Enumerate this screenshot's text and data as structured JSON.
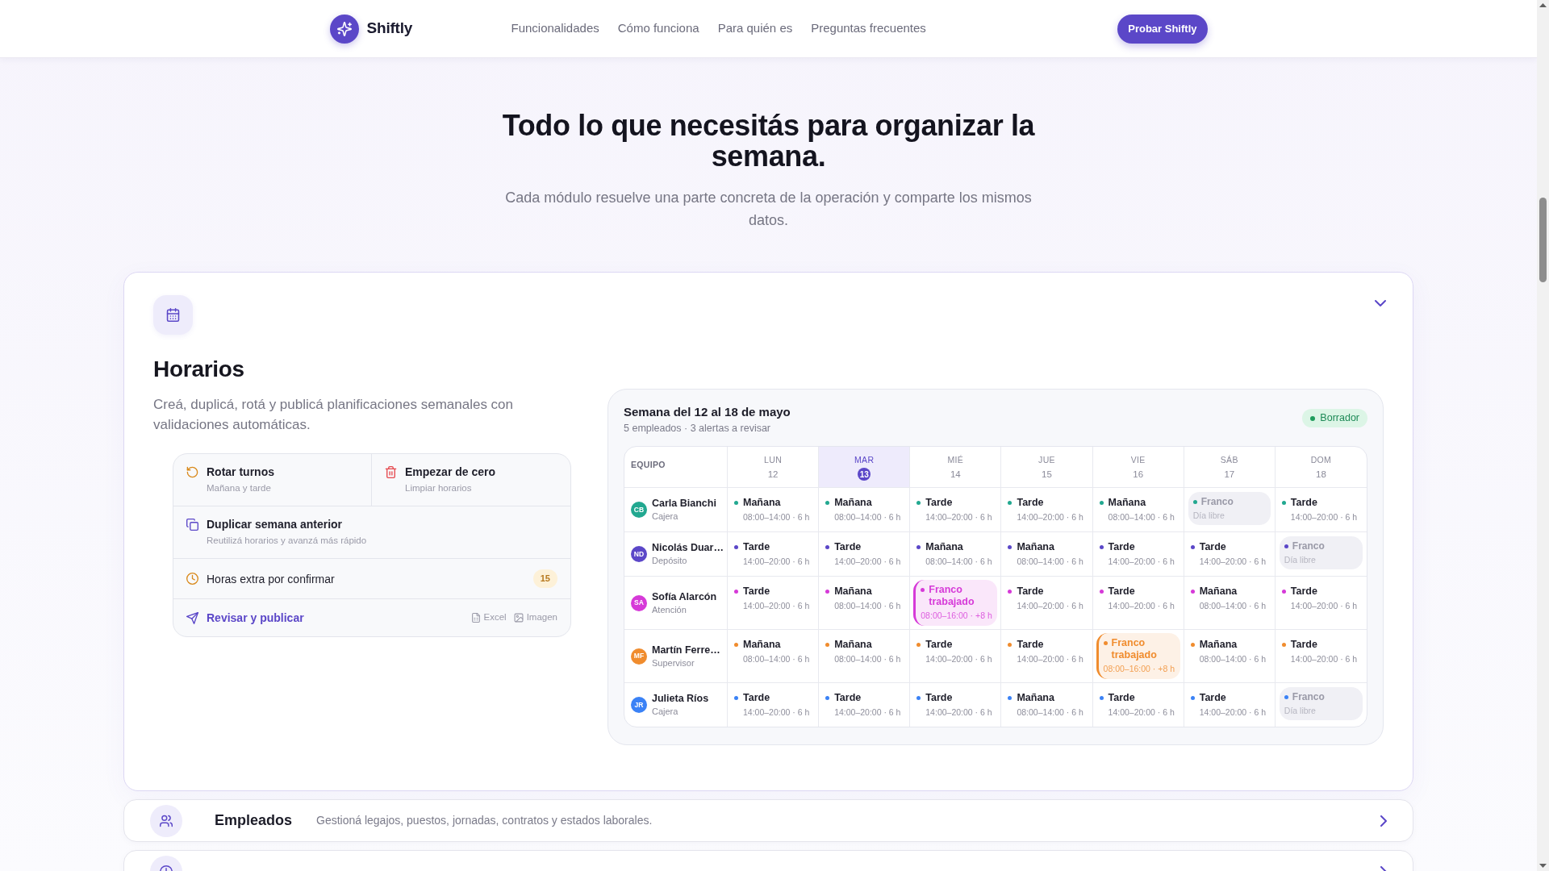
{
  "header": {
    "logo": "Shiftly",
    "nav": [
      "Funcionalidades",
      "Cómo funciona",
      "Para quién es",
      "Preguntas frecuentes"
    ],
    "cta": "Probar Shiftly"
  },
  "hero": {
    "title": "Todo lo que necesitás para organizar la semana.",
    "subtitle": "Cada módulo resuelve una parte concreta de la operación y comparte los mismos datos."
  },
  "modules": [
    {
      "title": "Horarios",
      "description": "Creá, duplicá, rotá y publicá planificaciones semanales con validaciones automáticas.",
      "expanded": true,
      "action_rows": [
        [
          {
            "kind": "action",
            "title": "Rotar turnos",
            "subtitle": "Mañana y tarde"
          },
          {
            "kind": "action",
            "title": "Empezar de cero",
            "subtitle": "Limpiar horarios"
          }
        ],
        [
          {
            "kind": "action",
            "title": "Duplicar semana anterior",
            "subtitle": "Reutilizá horarios y avanzá más rápido"
          }
        ],
        [
          {
            "kind": "pending",
            "title": "Horas extra por confirmar",
            "count": "15"
          }
        ],
        [
          {
            "kind": "publish",
            "title": "Revisar y publicar",
            "exports": [
              "Excel",
              "Imagen"
            ]
          }
        ]
      ],
      "schedule": {
        "title": "Semana del 12 al 18 de mayo",
        "subtitle": "5 empleados · 3 alertas a revisar",
        "status": "Borrador",
        "team_header": "EQUIPO",
        "days": [
          {
            "name": "LUN",
            "date": "12",
            "selected": false
          },
          {
            "name": "MAR",
            "date": "13",
            "selected": true
          },
          {
            "name": "MIÉ",
            "date": "14",
            "selected": false
          },
          {
            "name": "JUE",
            "date": "15",
            "selected": false
          },
          {
            "name": "VIE",
            "date": "16",
            "selected": false
          },
          {
            "name": "SÁB",
            "date": "17",
            "selected": false
          },
          {
            "name": "DOM",
            "date": "18",
            "selected": false
          }
        ],
        "employees": [
          {
            "initials": "CB",
            "name": "Carla Bianchi",
            "role": "Cajera",
            "color": "#22a890",
            "shifts": [
              {
                "kind": "shift",
                "label": "Mañana",
                "time": "08:00–14:00 · 6 h"
              },
              {
                "kind": "shift",
                "label": "Mañana",
                "time": "08:00–14:00 · 6 h"
              },
              {
                "kind": "shift",
                "label": "Tarde",
                "time": "14:00–20:00 · 6 h"
              },
              {
                "kind": "shift",
                "label": "Tarde",
                "time": "14:00–20:00 · 6 h"
              },
              {
                "kind": "shift",
                "label": "Mañana",
                "time": "08:00–14:00 · 6 h"
              },
              {
                "kind": "off",
                "label": "Franco",
                "note": "Día libre"
              },
              {
                "kind": "shift",
                "label": "Tarde",
                "time": "14:00–20:00 · 6 h"
              }
            ]
          },
          {
            "initials": "ND",
            "name": "Nicolás Duar…",
            "role": "Depósito",
            "color": "#5b47c8",
            "shifts": [
              {
                "kind": "shift",
                "label": "Tarde",
                "time": "14:00–20:00 · 6 h"
              },
              {
                "kind": "shift",
                "label": "Tarde",
                "time": "14:00–20:00 · 6 h"
              },
              {
                "kind": "shift",
                "label": "Mañana",
                "time": "08:00–14:00 · 6 h"
              },
              {
                "kind": "shift",
                "label": "Mañana",
                "time": "08:00–14:00 · 6 h"
              },
              {
                "kind": "shift",
                "label": "Tarde",
                "time": "14:00–20:00 · 6 h"
              },
              {
                "kind": "shift",
                "label": "Tarde",
                "time": "14:00–20:00 · 6 h"
              },
              {
                "kind": "off",
                "label": "Franco",
                "note": "Día libre"
              }
            ]
          },
          {
            "initials": "SA",
            "name": "Sofía Alarcón",
            "role": "Atención",
            "color": "#d63ad8",
            "shifts": [
              {
                "kind": "shift",
                "label": "Tarde",
                "time": "14:00–20:00 · 6 h"
              },
              {
                "kind": "shift",
                "label": "Mañana",
                "time": "08:00–14:00 · 6 h"
              },
              {
                "kind": "worked_off",
                "label": "Franco trabajado",
                "time": "08:00–16:00 · +8 h"
              },
              {
                "kind": "shift",
                "label": "Tarde",
                "time": "14:00–20:00 · 6 h"
              },
              {
                "kind": "shift",
                "label": "Tarde",
                "time": "14:00–20:00 · 6 h"
              },
              {
                "kind": "shift",
                "label": "Mañana",
                "time": "08:00–14:00 · 6 h"
              },
              {
                "kind": "shift",
                "label": "Tarde",
                "time": "14:00–20:00 · 6 h"
              }
            ]
          },
          {
            "initials": "MF",
            "name": "Martín Ferre…",
            "role": "Supervisor",
            "color": "#f08c2e",
            "shifts": [
              {
                "kind": "shift",
                "label": "Mañana",
                "time": "08:00–14:00 · 6 h"
              },
              {
                "kind": "shift",
                "label": "Mañana",
                "time": "08:00–14:00 · 6 h"
              },
              {
                "kind": "shift",
                "label": "Tarde",
                "time": "14:00–20:00 · 6 h"
              },
              {
                "kind": "shift",
                "label": "Tarde",
                "time": "14:00–20:00 · 6 h"
              },
              {
                "kind": "worked_off",
                "label": "Franco trabajado",
                "time": "08:00–16:00 · +8 h"
              },
              {
                "kind": "shift",
                "label": "Mañana",
                "time": "08:00–14:00 · 6 h"
              },
              {
                "kind": "shift",
                "label": "Tarde",
                "time": "14:00–20:00 · 6 h"
              }
            ]
          },
          {
            "initials": "JR",
            "name": "Julieta Ríos",
            "role": "Cajera",
            "color": "#3b82f6",
            "shifts": [
              {
                "kind": "shift",
                "label": "Tarde",
                "time": "14:00–20:00 · 6 h"
              },
              {
                "kind": "shift",
                "label": "Tarde",
                "time": "14:00–20:00 · 6 h"
              },
              {
                "kind": "shift",
                "label": "Tarde",
                "time": "14:00–20:00 · 6 h"
              },
              {
                "kind": "shift",
                "label": "Mañana",
                "time": "08:00–14:00 · 6 h"
              },
              {
                "kind": "shift",
                "label": "Tarde",
                "time": "14:00–20:00 · 6 h"
              },
              {
                "kind": "shift",
                "label": "Tarde",
                "time": "14:00–20:00 · 6 h"
              },
              {
                "kind": "off",
                "label": "Franco",
                "note": "Día libre"
              }
            ]
          }
        ]
      }
    },
    {
      "title": "Empleados",
      "description": "Gestioná legajos, puestos, jornadas, contratos y estados laborales.",
      "expanded": false
    },
    {
      "expanded": false
    }
  ]
}
